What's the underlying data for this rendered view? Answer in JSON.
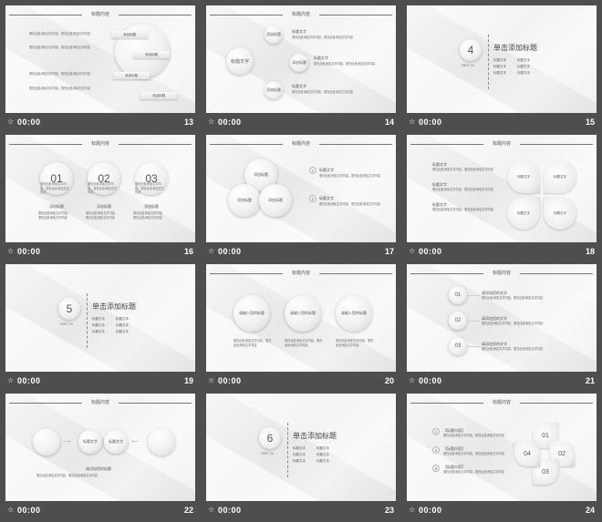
{
  "common": {
    "time": "00:00",
    "star": "☆",
    "header_title": "标题内容",
    "body_text": "需在此处添加文字内容，需在此处添加文字内容",
    "add_label": "添加标题",
    "title_text": "标题文字",
    "click_title": "单击添加标题",
    "bullet": "标题文本"
  },
  "slides": [
    {
      "number": "13"
    },
    {
      "number": "14",
      "center_label": "标题文字"
    },
    {
      "number": "15",
      "section_num": "4",
      "part": "PART 04"
    },
    {
      "number": "16",
      "nums": [
        "01",
        "02",
        "03"
      ]
    },
    {
      "number": "17"
    },
    {
      "number": "18"
    },
    {
      "number": "19",
      "section_num": "5",
      "part": "PART 05"
    },
    {
      "number": "20",
      "center_label": "请输入您的标题"
    },
    {
      "number": "21",
      "nums": [
        "01",
        "02",
        "03"
      ],
      "right_title": "请添加您的文字"
    },
    {
      "number": "22",
      "caption": "请添加您的标题"
    },
    {
      "number": "23",
      "section_num": "6",
      "part": "PART 06"
    },
    {
      "number": "24",
      "nums": [
        "01",
        "02",
        "03",
        "04"
      ],
      "list": [
        "1",
        "2",
        "3"
      ],
      "list_label": "【标题内容】"
    }
  ]
}
